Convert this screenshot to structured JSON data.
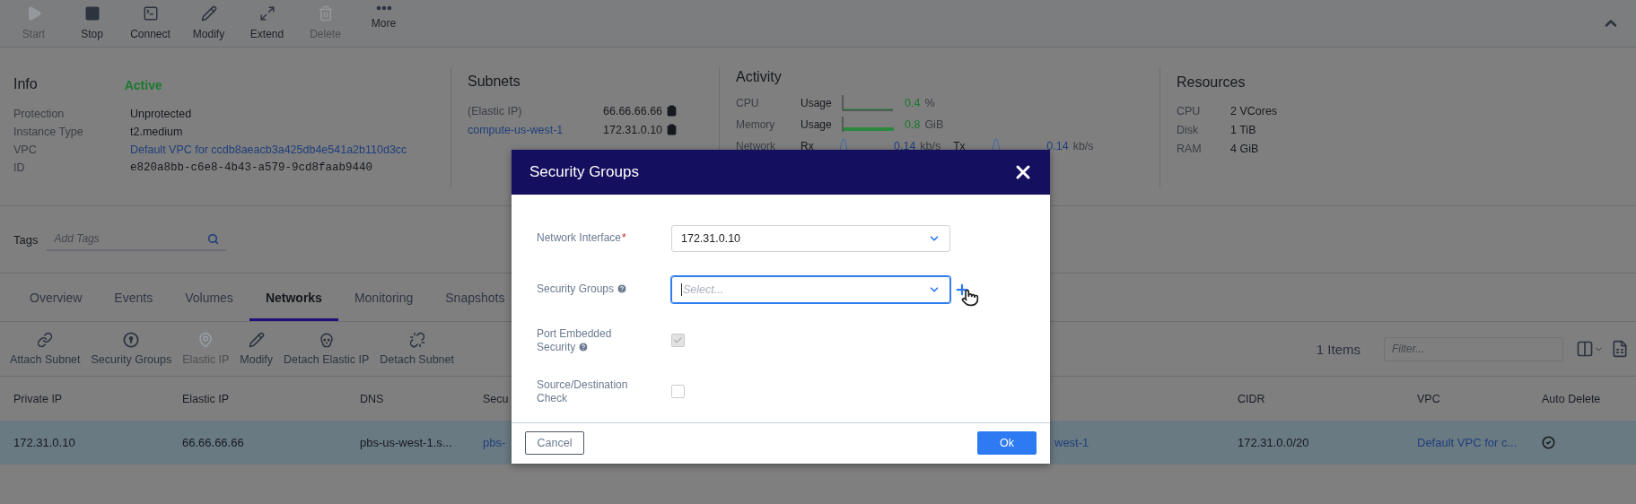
{
  "toolbar": {
    "actions": [
      {
        "label": "Start",
        "kind": "play",
        "disabled": true
      },
      {
        "label": "Stop",
        "kind": "stop",
        "disabled": false
      },
      {
        "label": "Connect",
        "kind": "terminal",
        "disabled": false
      },
      {
        "label": "Modify",
        "kind": "pencil",
        "disabled": false
      },
      {
        "label": "Extend",
        "kind": "expand",
        "disabled": false
      },
      {
        "label": "Delete",
        "kind": "trash",
        "disabled": true
      },
      {
        "label": "More",
        "kind": "dots",
        "disabled": false
      }
    ]
  },
  "info": {
    "title": "Info",
    "status": "Active",
    "fields": [
      {
        "label": "Protection",
        "value": "Unprotected",
        "kind": "plain"
      },
      {
        "label": "Instance Type",
        "value": "t2.medium",
        "kind": "plain"
      },
      {
        "label": "VPC",
        "value": "Default VPC for ccdb8aeacb3a425db4e541a2b110d3cc",
        "kind": "link"
      },
      {
        "label": "ID",
        "value": "e820a8bb-c6e8-4b43-a579-9cd8faab9440",
        "kind": "mono"
      }
    ]
  },
  "subnets": {
    "title": "Subnets",
    "rows": [
      {
        "name": "(Elastic IP)",
        "kind": "plain",
        "address": "66.66.66.66"
      },
      {
        "name": "compute-us-west-1",
        "kind": "link",
        "address": "172.31.0.10"
      }
    ]
  },
  "activity": {
    "title": "Activity",
    "metrics": [
      {
        "label": "CPU",
        "kind": "sparkline",
        "measure": "Usage",
        "value": "0.4",
        "unit": "%"
      },
      {
        "label": "Memory",
        "kind": "bar",
        "measure": "Usage",
        "value": "0.8",
        "unit": "GiB"
      },
      {
        "label": "Network",
        "kind": "traffic",
        "rx_label": "Rx",
        "rx_value": "0.14",
        "rx_unit": "kb/s",
        "tx_label": "Tx",
        "tx_value": "0.14",
        "tx_unit": "kb/s"
      }
    ]
  },
  "resources": {
    "title": "Resources",
    "rows": [
      {
        "label": "CPU",
        "value": "2 VCores"
      },
      {
        "label": "Disk",
        "value": "1 TiB"
      },
      {
        "label": "RAM",
        "value": "4 GiB"
      }
    ]
  },
  "tags": {
    "label": "Tags",
    "placeholder": "Add Tags"
  },
  "tabs": [
    {
      "label": "Overview",
      "selected": false
    },
    {
      "label": "Events",
      "selected": false
    },
    {
      "label": "Volumes",
      "selected": false
    },
    {
      "label": "Networks",
      "selected": true
    },
    {
      "label": "Monitoring",
      "selected": false
    },
    {
      "label": "Snapshots",
      "selected": false
    }
  ],
  "network_actions": [
    {
      "label": "Attach Subnet",
      "kind": "link",
      "disabled": false
    },
    {
      "label": "Security Groups",
      "kind": "keyhole",
      "disabled": false
    },
    {
      "label": "Elastic IP",
      "kind": "pin",
      "disabled": true
    },
    {
      "label": "Modify",
      "kind": "pencil",
      "disabled": false
    },
    {
      "label": "Detach Elastic IP",
      "kind": "skull",
      "disabled": false
    },
    {
      "label": "Detach Subnet",
      "kind": "unlink",
      "disabled": false
    }
  ],
  "items_count": "1 Items",
  "filter": {
    "placeholder": "Filter..."
  },
  "table": {
    "columns": [
      {
        "label": "Private IP"
      },
      {
        "label": "Elastic IP"
      },
      {
        "label": "DNS"
      },
      {
        "label": "Secu"
      },
      {},
      {
        "label": "CIDR"
      },
      {
        "label": "VPC"
      },
      {
        "label": "Auto Delete"
      }
    ],
    "rows": [
      {
        "selected": true,
        "cells": [
          {
            "kind": "text",
            "text": "172.31.0.10"
          },
          {
            "kind": "text",
            "text": "66.66.66.66"
          },
          {
            "kind": "text",
            "text": "pbs-us-west-1.s..."
          },
          {
            "kind": "link",
            "text": "pbs-"
          },
          {
            "kind": "link",
            "text": "west-1"
          },
          {
            "kind": "text",
            "text": "172.31.0.0/20"
          },
          {
            "kind": "link",
            "text": "Default VPC for c..."
          },
          {
            "kind": "check"
          }
        ]
      }
    ]
  },
  "dialog": {
    "title": "Security Groups",
    "fields": [
      {
        "kind": "select",
        "label": "Network Interface",
        "required_mark": "*",
        "value": "172.31.0.10"
      },
      {
        "kind": "select",
        "label": "Security Groups",
        "help": true,
        "placeholder": "Select...",
        "focused": true,
        "add": true
      },
      {
        "kind": "checkbox",
        "label": "Port Embedded Security",
        "help": true,
        "checked": true,
        "disabled": true
      },
      {
        "kind": "checkbox",
        "label": "Source/Destination Check",
        "checked": false,
        "disabled": false
      }
    ],
    "buttons": [
      {
        "label": "Cancel",
        "kind": "secondary"
      },
      {
        "label": "Ok",
        "kind": "primary"
      }
    ]
  }
}
